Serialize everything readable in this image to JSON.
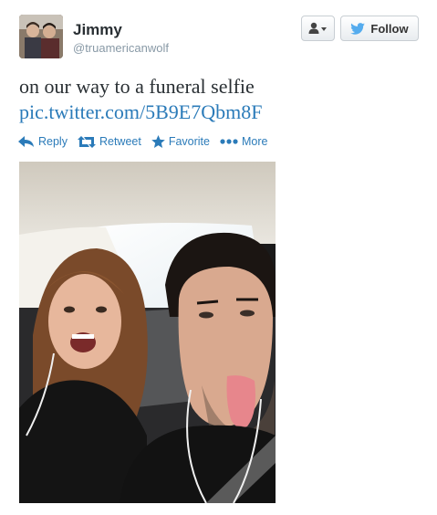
{
  "user": {
    "name": "Jimmy",
    "handle": "@truamericanwolf"
  },
  "buttons": {
    "follow_label": "Follow"
  },
  "tweet": {
    "text": "on our way to a funeral selfie",
    "link": "pic.twitter.com/5B9E7Qbm8F"
  },
  "actions": [
    {
      "label": "Reply",
      "icon": "reply-icon"
    },
    {
      "label": "Retweet",
      "icon": "retweet-icon"
    },
    {
      "label": "Favorite",
      "icon": "star-icon"
    },
    {
      "label": "More",
      "icon": "more-dots-icon"
    }
  ],
  "colors": {
    "link": "#2b7bb9",
    "text": "#292f33",
    "muted": "#8899a6",
    "twitter_blue": "#55acee"
  }
}
